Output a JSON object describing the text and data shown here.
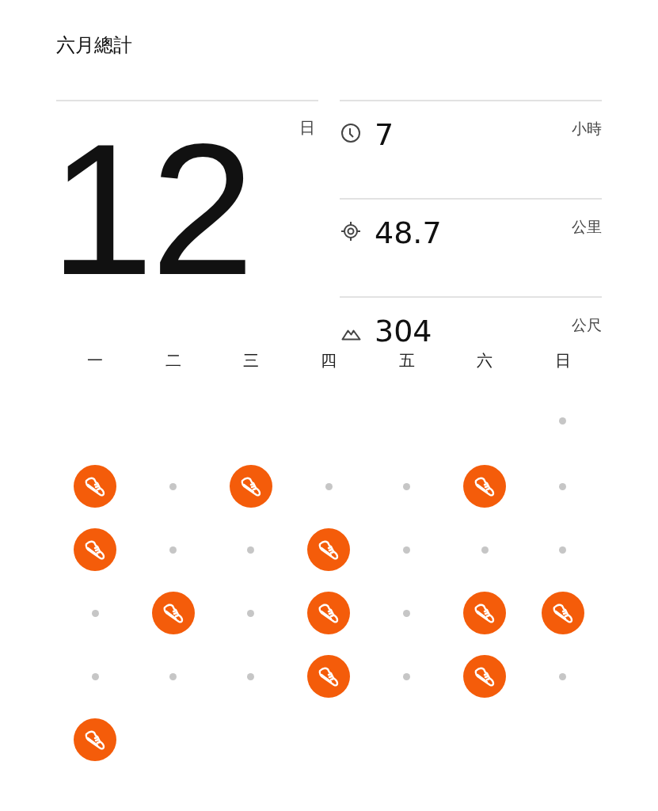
{
  "title": "六月總計",
  "days_total": {
    "value": "12",
    "unit": "日"
  },
  "stats": [
    {
      "kind": "time",
      "value": "7",
      "unit": "小時"
    },
    {
      "kind": "distance",
      "value": "48.7",
      "unit": "公里"
    },
    {
      "kind": "elevation",
      "value": "304",
      "unit": "公尺"
    }
  ],
  "weekdays": [
    "一",
    "二",
    "三",
    "四",
    "五",
    "六",
    "日"
  ],
  "weeks": [
    [
      {
        "kind": "empty"
      },
      {
        "kind": "empty"
      },
      {
        "kind": "empty"
      },
      {
        "kind": "empty"
      },
      {
        "kind": "empty"
      },
      {
        "kind": "empty"
      },
      {
        "kind": "rest"
      }
    ],
    [
      {
        "kind": "run"
      },
      {
        "kind": "rest"
      },
      {
        "kind": "run"
      },
      {
        "kind": "rest"
      },
      {
        "kind": "rest"
      },
      {
        "kind": "run"
      },
      {
        "kind": "rest"
      }
    ],
    [
      {
        "kind": "run"
      },
      {
        "kind": "rest"
      },
      {
        "kind": "rest"
      },
      {
        "kind": "run"
      },
      {
        "kind": "rest"
      },
      {
        "kind": "rest"
      },
      {
        "kind": "rest"
      }
    ],
    [
      {
        "kind": "rest"
      },
      {
        "kind": "run"
      },
      {
        "kind": "rest"
      },
      {
        "kind": "run"
      },
      {
        "kind": "rest"
      },
      {
        "kind": "run"
      },
      {
        "kind": "run"
      }
    ],
    [
      {
        "kind": "rest"
      },
      {
        "kind": "rest"
      },
      {
        "kind": "rest"
      },
      {
        "kind": "run"
      },
      {
        "kind": "rest"
      },
      {
        "kind": "run"
      },
      {
        "kind": "rest"
      }
    ],
    [
      {
        "kind": "run"
      }
    ]
  ]
}
